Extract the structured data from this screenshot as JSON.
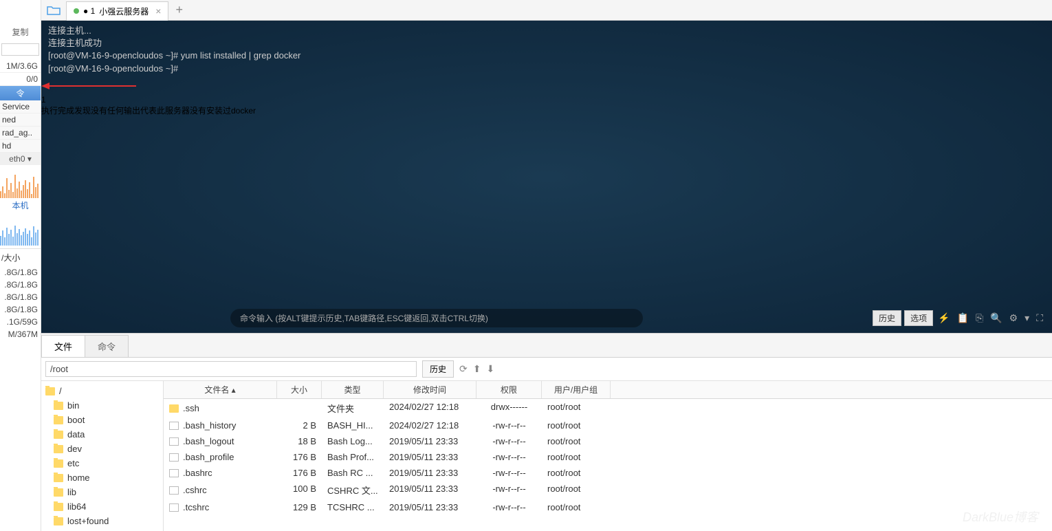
{
  "sidebar": {
    "copy": "复制",
    "stats": [
      "1M/3.6G",
      "0/0"
    ],
    "cmd_head": "令",
    "procs": [
      "Service",
      "ned",
      "rad_ag..",
      "hd"
    ],
    "net_label": "eth0 ▾",
    "self_label": "本机",
    "disk_head": "/大小",
    "disk_rows": [
      ".8G/1.8G",
      ".8G/1.8G",
      ".8G/1.8G",
      ".8G/1.8G",
      ".1G/59G",
      "M/367M"
    ]
  },
  "tabbar": {
    "tab_prefix": "● 1",
    "tab_title": "小强云服务器",
    "close": "×",
    "add": "+"
  },
  "terminal": {
    "lines": [
      "连接主机...",
      "连接主机成功",
      "[root@VM-16-9-opencloudos ~]# yum list installed | grep docker",
      "[root@VM-16-9-opencloudos ~]#"
    ],
    "badge": "1",
    "note": "执行完成发现没有任何输出代表此服务器没有安装过docker",
    "cmd_placeholder": "命令输入 (按ALT键提示历史,TAB键路径,ESC键返回,双击CTRL切换)",
    "history_btn": "历史",
    "options_btn": "选项"
  },
  "lower": {
    "tab_file": "文件",
    "tab_cmd": "命令",
    "path": "/root",
    "history_btn": "历史",
    "tree_root": "/",
    "tree": [
      "bin",
      "boot",
      "data",
      "dev",
      "etc",
      "home",
      "lib",
      "lib64",
      "lost+found"
    ],
    "headers": {
      "name": "文件名 ▴",
      "size": "大小",
      "type": "类型",
      "date": "修改时间",
      "perm": "权限",
      "user": "用户/用户组"
    },
    "rows": [
      {
        "icon": "folder",
        "name": ".ssh",
        "size": "",
        "type": "文件夹",
        "date": "2024/02/27 12:18",
        "perm": "drwx------",
        "user": "root/root"
      },
      {
        "icon": "file",
        "name": ".bash_history",
        "size": "2 B",
        "type": "BASH_HI...",
        "date": "2024/02/27 12:18",
        "perm": "-rw-r--r--",
        "user": "root/root"
      },
      {
        "icon": "file",
        "name": ".bash_logout",
        "size": "18 B",
        "type": "Bash Log...",
        "date": "2019/05/11 23:33",
        "perm": "-rw-r--r--",
        "user": "root/root"
      },
      {
        "icon": "file",
        "name": ".bash_profile",
        "size": "176 B",
        "type": "Bash Prof...",
        "date": "2019/05/11 23:33",
        "perm": "-rw-r--r--",
        "user": "root/root"
      },
      {
        "icon": "file",
        "name": ".bashrc",
        "size": "176 B",
        "type": "Bash RC ...",
        "date": "2019/05/11 23:33",
        "perm": "-rw-r--r--",
        "user": "root/root"
      },
      {
        "icon": "file",
        "name": ".cshrc",
        "size": "100 B",
        "type": "CSHRC 文...",
        "date": "2019/05/11 23:33",
        "perm": "-rw-r--r--",
        "user": "root/root"
      },
      {
        "icon": "file",
        "name": ".tcshrc",
        "size": "129 B",
        "type": "TCSHRC ...",
        "date": "2019/05/11 23:33",
        "perm": "-rw-r--r--",
        "user": "root/root"
      }
    ]
  },
  "watermark": "DarkBlue博客"
}
